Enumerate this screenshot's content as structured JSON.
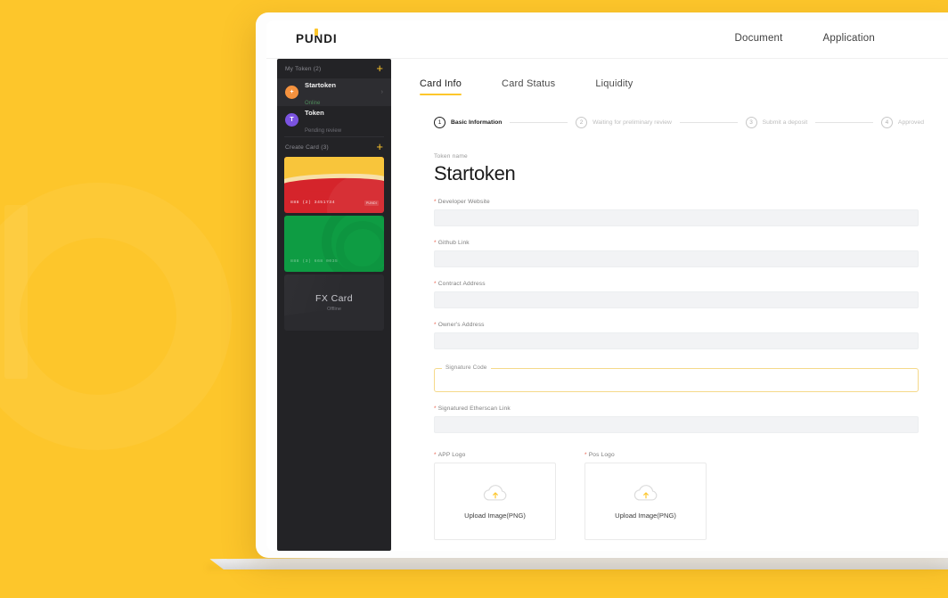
{
  "theme": {
    "brand_yellow": "#FDC62B",
    "sidebar_dark": "#232326",
    "required_red": "#E8604C",
    "online_green": "#4e8a5a"
  },
  "header": {
    "logo": "PUNDI",
    "nav": [
      {
        "label": "Document"
      },
      {
        "label": "Application"
      }
    ]
  },
  "sidebar": {
    "my_token": {
      "title": "My Token (2)",
      "add_icon": "+",
      "items": [
        {
          "avatar_letter": "+",
          "name": "Startoken",
          "status": "Online",
          "active": true
        },
        {
          "avatar_letter": "T",
          "name": "Token",
          "status": "Pending review",
          "active": false
        }
      ]
    },
    "create_card": {
      "title": "Create Card (3)",
      "add_icon": "+",
      "cards": [
        {
          "type": "red",
          "number": "888 (2) 3451734",
          "brand": "PUNDI"
        },
        {
          "type": "green",
          "number": "888 (3) 668 0035",
          "brand": ""
        },
        {
          "type": "fx",
          "title": "FX Card",
          "status": "Offline"
        }
      ]
    }
  },
  "main": {
    "tabs": [
      {
        "label": "Card Info",
        "active": true
      },
      {
        "label": "Card Status",
        "active": false
      },
      {
        "label": "Liquidity",
        "active": false
      }
    ],
    "stepper": [
      {
        "num": "1",
        "label": "Basic Information",
        "active": true
      },
      {
        "num": "2",
        "label": "Waiting for preliminary review",
        "active": false
      },
      {
        "num": "3",
        "label": "Submit a deposit",
        "active": false
      },
      {
        "num": "4",
        "label": "Approved",
        "active": false
      }
    ],
    "form": {
      "token_name_caption": "Token name",
      "token_name_value": "Startoken",
      "fields": [
        {
          "label": "Developer Website",
          "required": true,
          "value": ""
        },
        {
          "label": "Github Link",
          "required": true,
          "value": ""
        },
        {
          "label": "Contract Address",
          "required": true,
          "value": ""
        },
        {
          "label": "Owner's Address",
          "required": true,
          "value": ""
        }
      ],
      "signature": {
        "label": "Signature Code",
        "value": "",
        "highlighted": true
      },
      "etherscan": {
        "label": "Signatured Etherscan Link",
        "required": true,
        "value": ""
      },
      "uploads": [
        {
          "label": "APP Logo",
          "required": true,
          "text": "Upload Image(PNG)",
          "icon": "cloud-upload-icon"
        },
        {
          "label": "Pos Logo",
          "required": true,
          "text": "Upload Image(PNG)",
          "icon": "cloud-upload-icon"
        }
      ]
    }
  }
}
